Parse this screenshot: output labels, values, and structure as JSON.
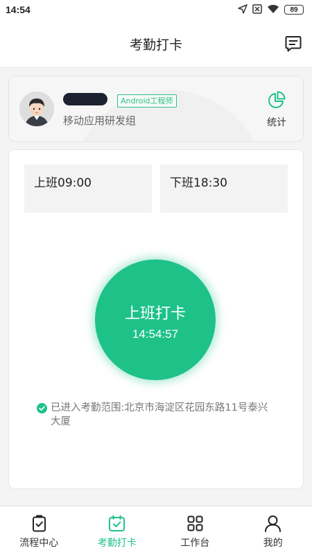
{
  "status_bar": {
    "time": "14:54",
    "battery": "89"
  },
  "header": {
    "title": "考勤打卡",
    "action_icon": "message-list-icon"
  },
  "profile": {
    "name": "",
    "role": "Android工程师",
    "department": "移动应用研发组",
    "stats_label": "统计",
    "stats_icon": "pie-chart-icon"
  },
  "attendance": {
    "shift_on": "上班09:00",
    "shift_off": "下班18:30",
    "punch_label": "上班打卡",
    "punch_time": "14:54:57",
    "location_text": "已进入考勤范围:北京市海淀区花园东路11号泰兴大厦"
  },
  "colors": {
    "accent": "#1ec289",
    "badge": "#2dbf8a"
  },
  "tabs": [
    {
      "label": "流程中心",
      "icon": "clipboard-check-icon",
      "active": false
    },
    {
      "label": "考勤打卡",
      "icon": "calendar-check-icon",
      "active": true
    },
    {
      "label": "工作台",
      "icon": "grid-icon",
      "active": false
    },
    {
      "label": "我的",
      "icon": "user-icon",
      "active": false
    }
  ]
}
